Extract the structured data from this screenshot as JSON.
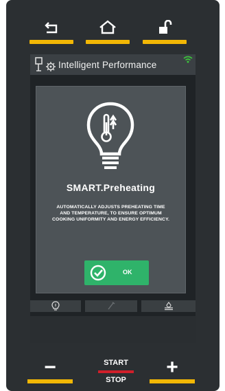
{
  "nav": {
    "back_icon": "back-arrow-icon",
    "home_icon": "home-icon",
    "lock_icon": "unlock-icon"
  },
  "header": {
    "title": "Intelligent Performance",
    "icon": "intelligent-performance-icon",
    "wifi_icon": "wifi-icon"
  },
  "popup": {
    "icon": "smart-preheating-bulb-icon",
    "title": "SMART.Preheating",
    "description": "AUTOMATICALLY ADJUSTS PREHEATING TIME AND TEMPERATURE, TO ENSURE OPTIMUM COOKING UNIFORMITY AND ENERGY EFFICIENCY.",
    "ok_label": "OK"
  },
  "tabs": [
    {
      "icon": "bulb-icon",
      "active": true
    },
    {
      "icon": "probe-icon",
      "active": false
    },
    {
      "icon": "water-level-icon",
      "active": false
    }
  ],
  "controls": {
    "minus_label": "−",
    "plus_label": "+",
    "start_label": "START",
    "stop_label": "STOP"
  },
  "colors": {
    "accent": "#f2b705",
    "ok_green": "#2fb36a",
    "start_red": "#d01f2a",
    "wifi_green": "#3cc43c"
  }
}
